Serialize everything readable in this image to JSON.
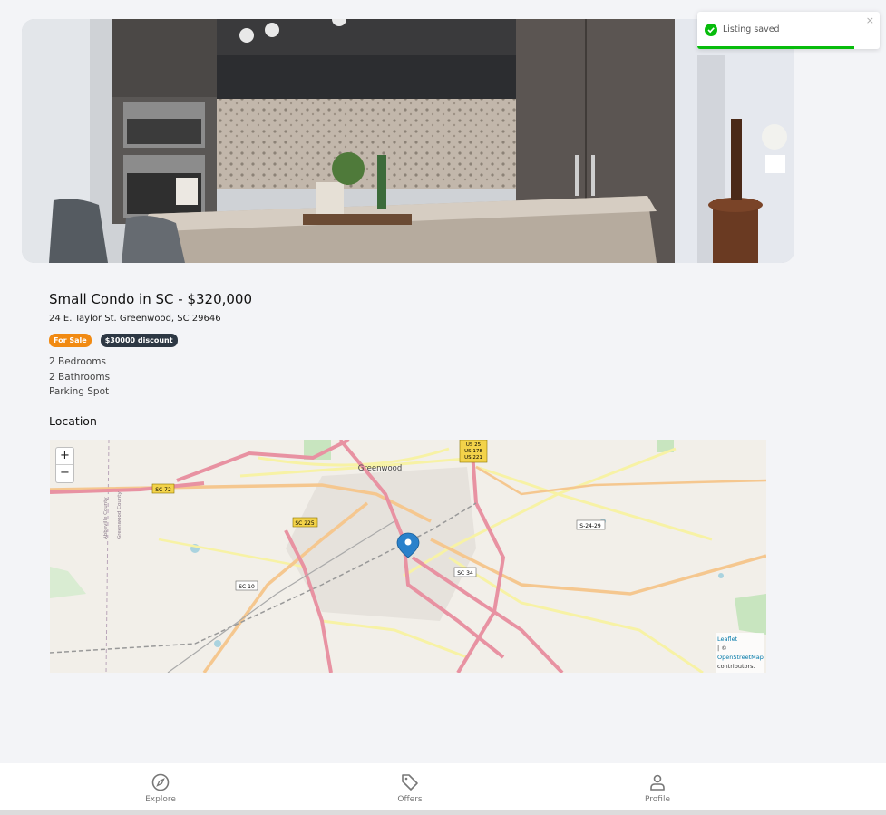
{
  "toast": {
    "message": "Listing saved",
    "close": "×",
    "progress_fraction": 0.86,
    "color": "#07bc0c"
  },
  "listing": {
    "title": "Small Condo in SC - $320,000",
    "address": "24 E. Taylor St. Greenwood, SC 29646",
    "badges": {
      "sale": "For Sale",
      "discount": "$30000 discount"
    },
    "features": [
      "2 Bedrooms",
      "2 Bathrooms",
      "Parking Spot"
    ]
  },
  "location": {
    "section_title": "Location"
  },
  "map": {
    "zoom_in": "+",
    "zoom_out": "−",
    "labels": {
      "city": "Greenwood",
      "sc72": "SC 72",
      "sc225": "SC 225",
      "sc10": "SC 10",
      "sc34": "SC 34",
      "s2429": "S-24-29",
      "us": [
        "US 25",
        "US 178",
        "US 221"
      ],
      "county1": "Abbeville County",
      "county2": "Greenwood County"
    },
    "attribution": {
      "leaflet": "Leaflet",
      "sep": "| ©",
      "osm": "OpenStreetMap",
      "contrib": "contributors."
    }
  },
  "nav": {
    "explore": "Explore",
    "offers": "Offers",
    "profile": "Profile"
  }
}
